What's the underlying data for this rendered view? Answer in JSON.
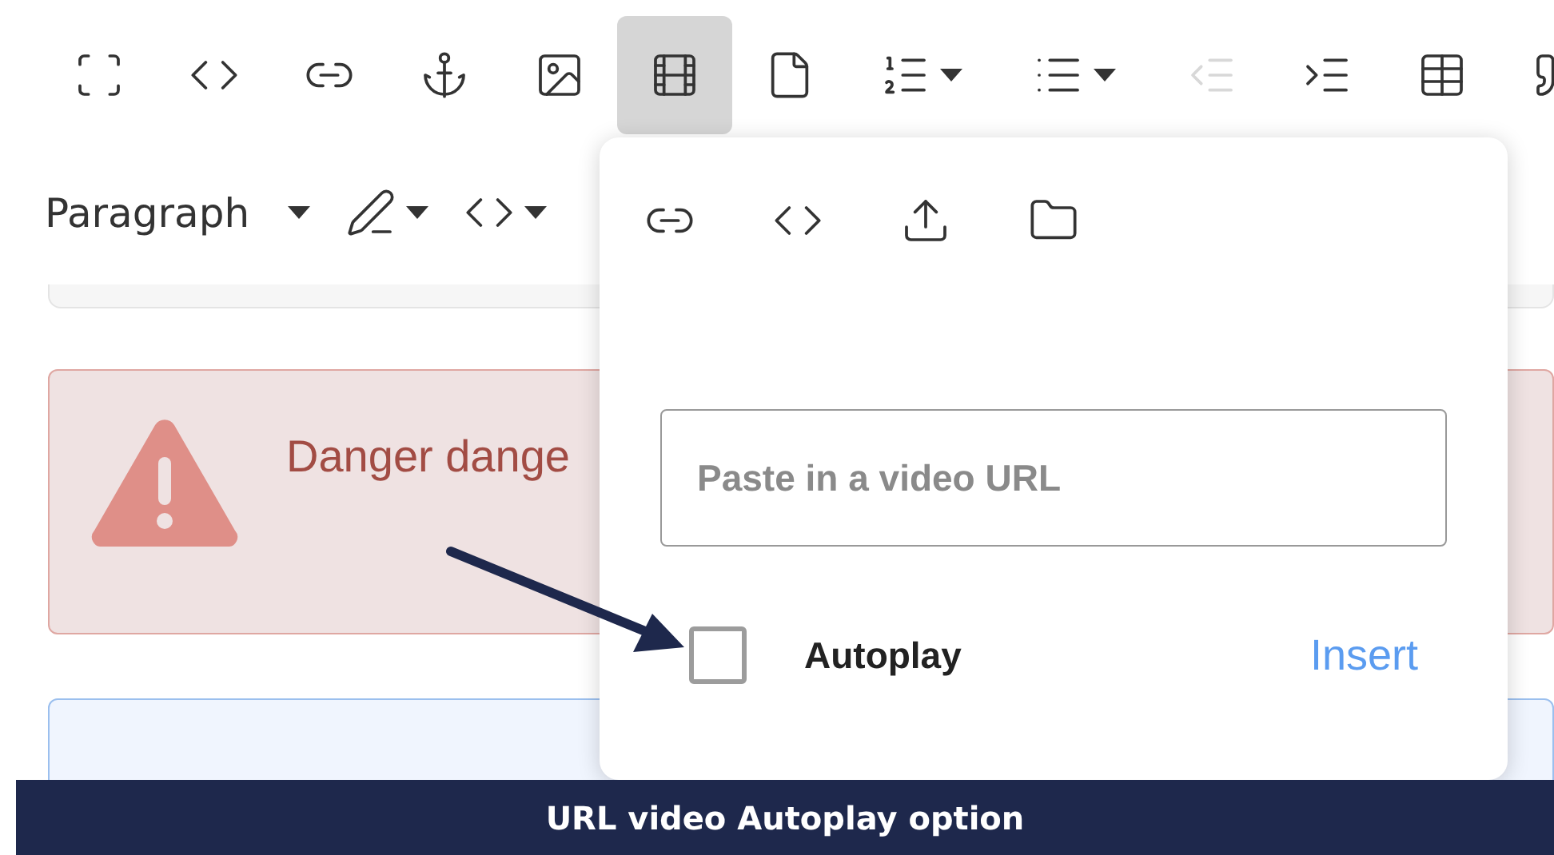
{
  "toolbar": [
    {
      "kind": "fullscreen",
      "selected": false,
      "disabled": false,
      "dropdown": false
    },
    {
      "kind": "code",
      "selected": false,
      "disabled": false,
      "dropdown": false
    },
    {
      "kind": "link",
      "selected": false,
      "disabled": false,
      "dropdown": false
    },
    {
      "kind": "anchor",
      "selected": false,
      "disabled": false,
      "dropdown": false
    },
    {
      "kind": "image",
      "selected": false,
      "disabled": false,
      "dropdown": false
    },
    {
      "kind": "video",
      "selected": true,
      "disabled": false,
      "dropdown": false
    },
    {
      "kind": "file",
      "selected": false,
      "disabled": false,
      "dropdown": false
    },
    {
      "kind": "ordered-list",
      "selected": false,
      "disabled": false,
      "dropdown": true
    },
    {
      "kind": "bullet-list",
      "selected": false,
      "disabled": false,
      "dropdown": true
    },
    {
      "kind": "outdent",
      "selected": false,
      "disabled": true,
      "dropdown": false
    },
    {
      "kind": "indent",
      "selected": false,
      "disabled": false,
      "dropdown": false
    },
    {
      "kind": "table",
      "selected": false,
      "disabled": false,
      "dropdown": false
    },
    {
      "kind": "quote",
      "selected": false,
      "disabled": false,
      "dropdown": false
    }
  ],
  "format_bar": {
    "block_style": "Paragraph"
  },
  "alert": {
    "text": "Danger dange"
  },
  "video_popover": {
    "tabs": [
      {
        "kind": "link"
      },
      {
        "kind": "code"
      },
      {
        "kind": "upload"
      },
      {
        "kind": "folder"
      }
    ],
    "url_field": {
      "placeholder": "Paste in a video URL"
    },
    "autoplay": {
      "label": "Autoplay",
      "checked": false
    },
    "insert_button": "Insert"
  },
  "caption": "URL video Autoplay option"
}
